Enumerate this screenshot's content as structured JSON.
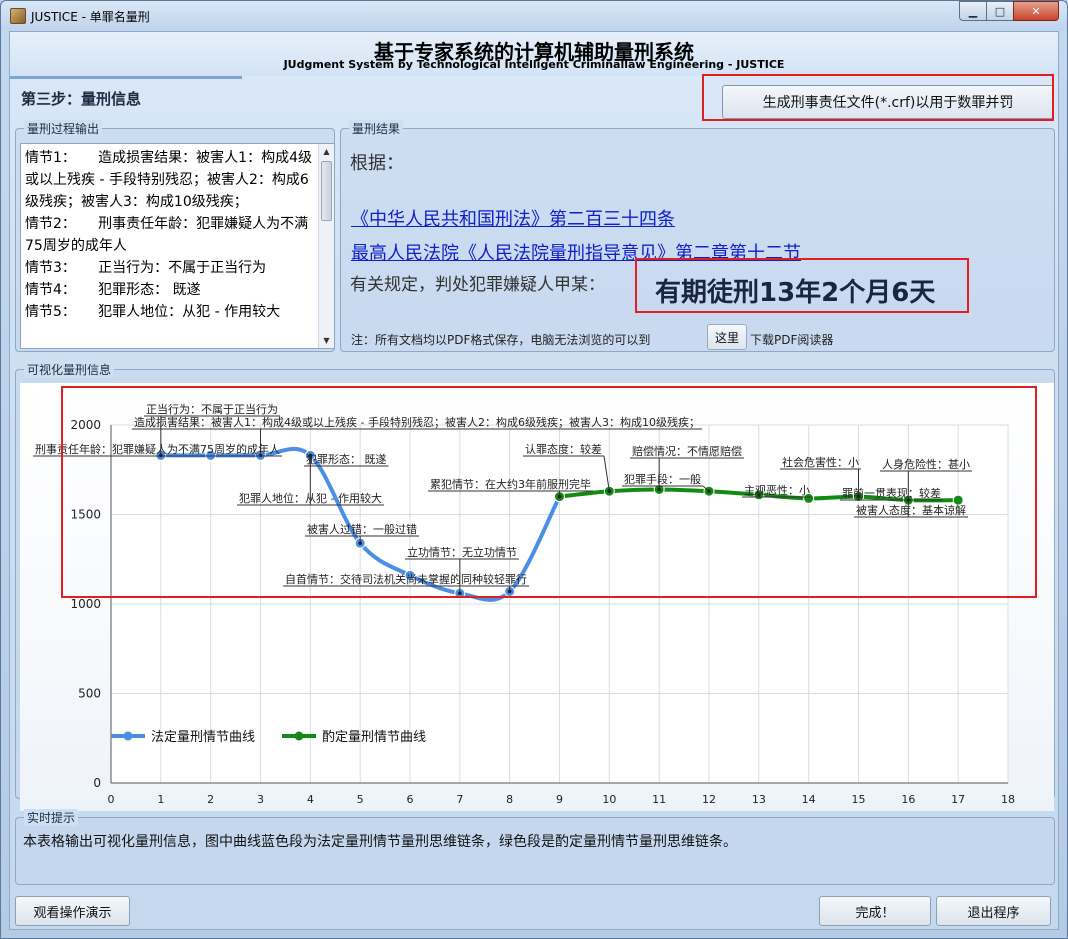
{
  "window": {
    "title": "JUSTICE - 单罪名量刑",
    "controls": {
      "minimize": "▁",
      "maximize": "□",
      "close": "✕"
    }
  },
  "header": {
    "title": "基于专家系统的计算机辅助量刑系统",
    "subtitle": "JUdgment System by Technological Intelligent Criminallaw Engineering - JUSTICE"
  },
  "step": {
    "label": "第三步：量刑信息"
  },
  "toolbar": {
    "crf_button_label": "生成刑事责任文件(*.crf)以用于数罪并罚"
  },
  "process_output": {
    "group_title": "量刑过程输出",
    "text": "情节1：     造成损害结果：被害人1：构成4级或以上残疾 - 手段特别残忍；被害人2：构成6级残疾；被害人3：构成10级残疾；\n情节2：     刑事责任年龄：犯罪嫌疑人为不满75周岁的成年人\n情节3：     正当行为：不属于正当行为\n情节4：     犯罪形态： 既遂\n情节5：     犯罪人地位：从犯 - 作用较大"
  },
  "result": {
    "group_title": "量刑结果",
    "basis_label": "根据：",
    "law_link_1": "《中华人民共和国刑法》第二百三十四条",
    "law_link_2": "最高人民法院《人民法院量刑指导意见》第二章第十二节",
    "rule_text": "有关规定，判处犯罪嫌疑人甲某：",
    "sentence": "有期徒刑13年2个月6天",
    "note_prefix": "注：所有文档均以PDF格式保存，电脑无法浏览的可以到",
    "note_button": "这里",
    "note_suffix": "下载PDF阅读器"
  },
  "visualization": {
    "group_title": "可视化量刑信息"
  },
  "tips": {
    "group_title": "实时提示",
    "text": "本表格输出可视化量刑信息，图中曲线蓝色段为法定量刑情节量刑思维链条，绿色段是酌定量刑情节量刑思维链条。"
  },
  "footer": {
    "demo_button": "观看操作演示",
    "done_button": "完成！",
    "exit_button": "退出程序"
  },
  "colors": {
    "statutory_series": "#4a8ee6",
    "discretionary_series": "#138a13",
    "highlight_box": "#e02020",
    "link": "#1020c8"
  },
  "chart_data": {
    "type": "line",
    "xlim": [
      0,
      18
    ],
    "ylim": [
      0,
      2000
    ],
    "x_ticks": [
      0,
      1,
      2,
      3,
      4,
      5,
      6,
      7,
      8,
      9,
      10,
      11,
      12,
      13,
      14,
      15,
      16,
      17,
      18
    ],
    "y_ticks": [
      0,
      500,
      1000,
      1500,
      2000
    ],
    "grid": true,
    "legend_position": "bottom-left",
    "series": [
      {
        "name": "法定量刑情节曲线",
        "color": "#4a8ee6",
        "x": [
          1,
          2,
          3,
          4,
          5,
          6,
          7,
          8,
          9
        ],
        "y": [
          1830,
          1830,
          1830,
          1830,
          1340,
          1160,
          1060,
          1070,
          1600
        ]
      },
      {
        "name": "酌定量刑情节曲线",
        "color": "#138a13",
        "x": [
          9,
          10,
          11,
          12,
          13,
          14,
          15,
          16,
          17
        ],
        "y": [
          1600,
          1630,
          1640,
          1630,
          1610,
          1590,
          1600,
          1580,
          1580
        ]
      }
    ],
    "annotations": [
      "正当行为：不属于正当行为",
      "造成损害结果：被害人1：构成4级或以上残疾 - 手段特别残忍；被害人2：构成6级残疾；被害人3：构成10级残疾；",
      "刑事责任年龄：犯罪嫌疑人为不满75周岁的成年人",
      "犯罪形态： 既遂",
      "犯罪人地位：从犯 - 作用较大",
      "被害人过错：一般过错",
      "立功情节：无立功情节",
      "自首情节：交待司法机关尚未掌握的同种较轻罪行",
      "累犯情节：在大约3年前服刑完毕",
      "认罪态度：较差",
      "赔偿情况：不情愿赔偿",
      "犯罪手段：一般",
      "主观恶性：小",
      "社会危害性：小",
      "罪前一贯表现：较差",
      "人身危险性：甚小",
      "被害人态度：基本谅解"
    ]
  }
}
